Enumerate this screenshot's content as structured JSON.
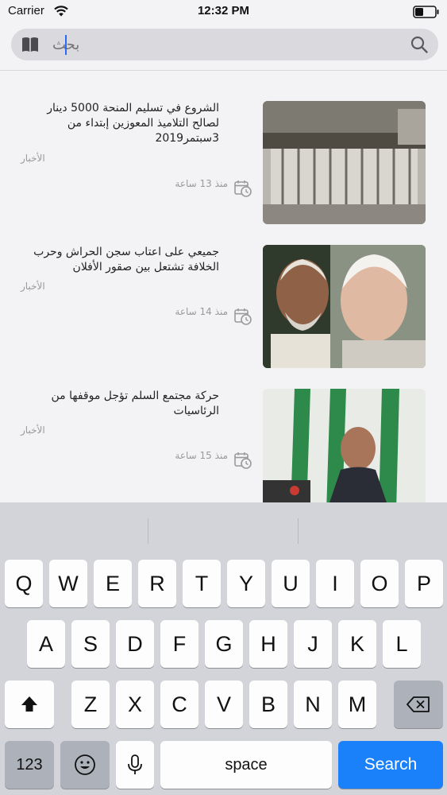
{
  "status_bar": {
    "carrier": "Carrier",
    "time": "12:32 PM"
  },
  "search": {
    "placeholder": "بحث"
  },
  "news": [
    {
      "title": "الشروع في تسليم المنحة 5000 دينار لصالح التلاميذ المعوزين إبتداء من 3سبتمر2019",
      "category": "الأخبار",
      "time": "منذ 13 ساعة"
    },
    {
      "title": "جميعي على اعتاب سجن الحراش وحرب الخلافة تشتعل بين صقور الأفلان",
      "category": "الأخبار",
      "time": "منذ 14 ساعة"
    },
    {
      "title": "حركة مجتمع السلم تؤجل موقفها من الرئاسيات",
      "category": "الأخبار",
      "time": "منذ 15 ساعة"
    }
  ],
  "keyboard": {
    "row1": [
      "Q",
      "W",
      "E",
      "R",
      "T",
      "Y",
      "U",
      "I",
      "O",
      "P"
    ],
    "row2": [
      "A",
      "S",
      "D",
      "F",
      "G",
      "H",
      "J",
      "K",
      "L"
    ],
    "row3": [
      "Z",
      "X",
      "C",
      "V",
      "B",
      "N",
      "M"
    ],
    "numbers_label": "123",
    "space_label": "space",
    "search_label": "Search"
  },
  "colors": {
    "accent": "#1a81fb",
    "caret": "#2b6bf3",
    "keyboard_bg": "#d2d4d9"
  }
}
